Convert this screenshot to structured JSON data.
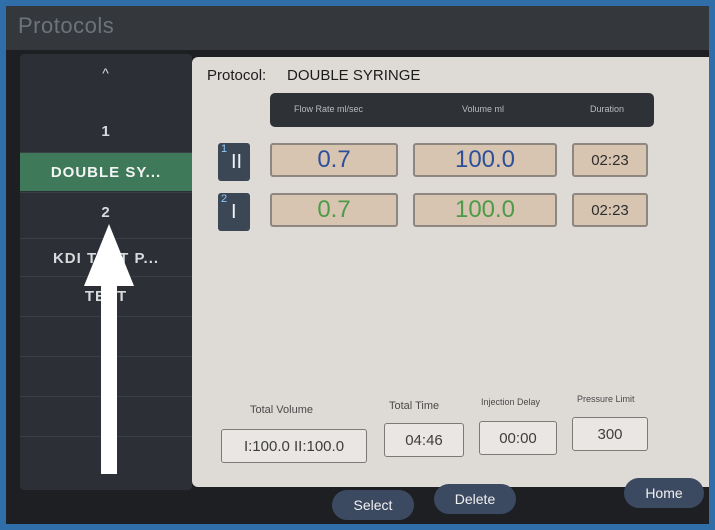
{
  "window": {
    "title": "Protocols"
  },
  "sidebar": {
    "items": [
      {
        "label": "^"
      },
      {
        "label": "1"
      },
      {
        "label": "DOUBLE SY...",
        "active": true
      },
      {
        "label": "2"
      },
      {
        "label": "KDI TEST P..."
      },
      {
        "label": "TEST"
      },
      {
        "label": ""
      },
      {
        "label": ""
      },
      {
        "label": ""
      },
      {
        "label": ""
      }
    ]
  },
  "protocol": {
    "label": "Protocol:",
    "name": "DOUBLE SYRINGE",
    "headers": {
      "flow_rate": "Flow Rate ml/sec",
      "volume": "Volume ml",
      "duration": "Duration"
    },
    "rows": [
      {
        "index": "1",
        "syringe": "II",
        "flow_rate": "0.7",
        "volume": "100.0",
        "duration": "02:23",
        "color": "#2e4f9a"
      },
      {
        "index": "2",
        "syringe": "I",
        "flow_rate": "0.7",
        "volume": "100.0",
        "duration": "02:23",
        "color": "#4d9a48"
      }
    ]
  },
  "summary": {
    "total_volume_label": "Total Volume",
    "total_volume": "I:100.0 II:100.0",
    "total_time_label": "Total Time",
    "total_time": "04:46",
    "injection_delay_label": "Injection Delay",
    "injection_delay": "00:00",
    "pressure_limit_label": "Pressure Limit",
    "pressure_limit": "300"
  },
  "buttons": {
    "select": "Select",
    "delete": "Delete",
    "home": "Home"
  },
  "annotation": {
    "arrow_color": "#ffffff",
    "direction": "up"
  }
}
